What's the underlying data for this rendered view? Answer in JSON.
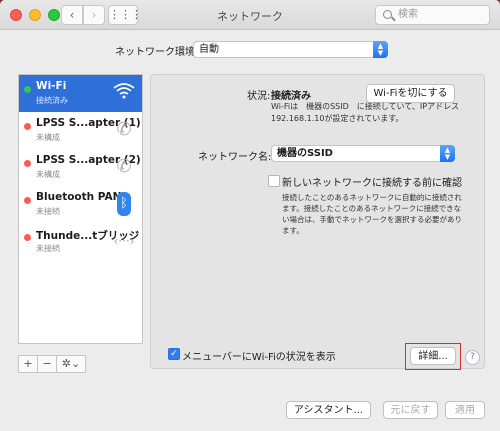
{
  "window": {
    "title": "ネットワーク",
    "search_placeholder": "検索"
  },
  "location": {
    "label": "ネットワーク環境:",
    "value": "自動"
  },
  "services": [
    {
      "name": "Wi-Fi",
      "status": "接続済み",
      "dot_color": "#34c759",
      "icon": "wifi-icon",
      "selected": true
    },
    {
      "name": "LPSS S...apter (1)",
      "status": "未構成",
      "dot_color": "#ff5a4e",
      "icon": "phone-icon",
      "selected": false
    },
    {
      "name": "LPSS S...apter (2)",
      "status": "未構成",
      "dot_color": "#ff5a4e",
      "icon": "phone-icon",
      "selected": false
    },
    {
      "name": "Bluetooth PAN",
      "status": "未接続",
      "dot_color": "#ff5a4e",
      "icon": "bluetooth-icon",
      "selected": false
    },
    {
      "name": "Thunde...tブリッジ",
      "status": "未接続",
      "dot_color": "#ff5a4e",
      "icon": "thunderbolt-bridge-icon",
      "selected": false
    }
  ],
  "toolbar": {
    "add": "+",
    "remove": "−",
    "actions": "✲⌄"
  },
  "detail": {
    "status_label": "状況:",
    "status_value": "接続済み",
    "wifi_off_button": "Wi-Fiを切にする",
    "status_desc": "Wi-Fiは　機器のSSID　に接続していて、IPアドレス 192.168.1.10が設定されています。",
    "network_name_label": "ネットワーク名:",
    "network_name_value": "機器のSSID",
    "ask_label": "新しいネットワークに接続する前に確認",
    "ask_desc": "接続したことのあるネットワークに自動的に接続されます。接続したことのあるネットワークに接続できない場合は、手動でネットワークを選択する必要があります。",
    "ask_checked": false,
    "menubar_label": "メニューバーにWi-Fiの状況を表示",
    "menubar_checked": true,
    "advanced_button": "詳細...",
    "help": "?"
  },
  "footer": {
    "assistant": "アシスタント...",
    "revert": "元に戻す",
    "apply": "適用"
  }
}
